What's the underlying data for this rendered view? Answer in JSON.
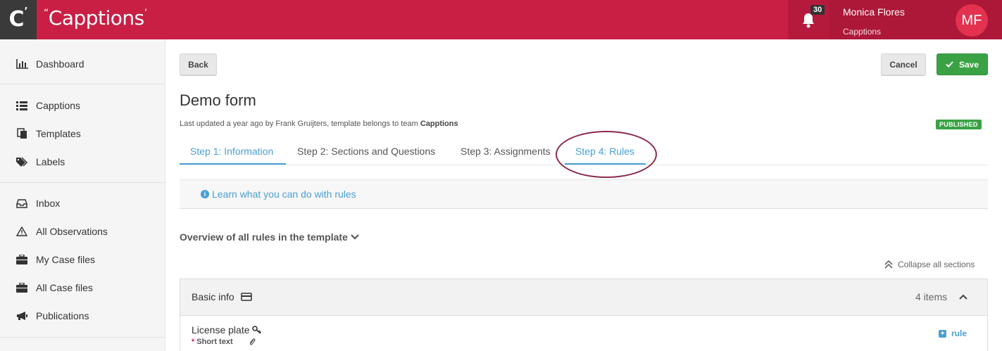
{
  "header": {
    "logo_mark": "C",
    "brand": "Capptions",
    "notifications_count": "30",
    "user_name": "Monica Flores",
    "user_team": "Capptions",
    "avatar_initials": "MF"
  },
  "sidebar": {
    "items": [
      {
        "label": "Dashboard",
        "icon": "bar-chart-icon"
      },
      {
        "label": "Capptions",
        "icon": "list-icon"
      },
      {
        "label": "Templates",
        "icon": "copy-icon"
      },
      {
        "label": "Labels",
        "icon": "tags-icon"
      },
      {
        "label": "Inbox",
        "icon": "inbox-icon"
      },
      {
        "label": "All Observations",
        "icon": "warning-icon"
      },
      {
        "label": "My Case files",
        "icon": "briefcase-icon"
      },
      {
        "label": "All Case files",
        "icon": "briefcase-icon"
      },
      {
        "label": "Publications",
        "icon": "megaphone-icon"
      }
    ]
  },
  "toolbar": {
    "back_label": "Back",
    "cancel_label": "Cancel",
    "save_label": "Save"
  },
  "form": {
    "title": "Demo form",
    "updated_prefix": "Last updated a year ago by Frank Gruijters, template belongs to team ",
    "team": "Capptions",
    "status": "PUBLISHED"
  },
  "tabs": [
    {
      "label": "Step 1: Information",
      "active": true
    },
    {
      "label": "Step 2: Sections and Questions",
      "active": false
    },
    {
      "label": "Step 3: Assignments",
      "active": false
    },
    {
      "label": "Step 4: Rules",
      "active": true
    }
  ],
  "info": {
    "learn_link": "Learn what you can do with rules"
  },
  "overview": {
    "label": "Overview of all rules in the template",
    "collapse_all": "Collapse all sections"
  },
  "section": {
    "title": "Basic info",
    "count": "4 items",
    "questions": [
      {
        "label": "License plate",
        "type": "Short text",
        "required": "*",
        "action": "rule"
      }
    ]
  },
  "colors": {
    "brand": "#c91f45",
    "accent": "#4a9fd5",
    "success": "#3aa244",
    "highlight_ellipse": "#8c2a4a"
  }
}
